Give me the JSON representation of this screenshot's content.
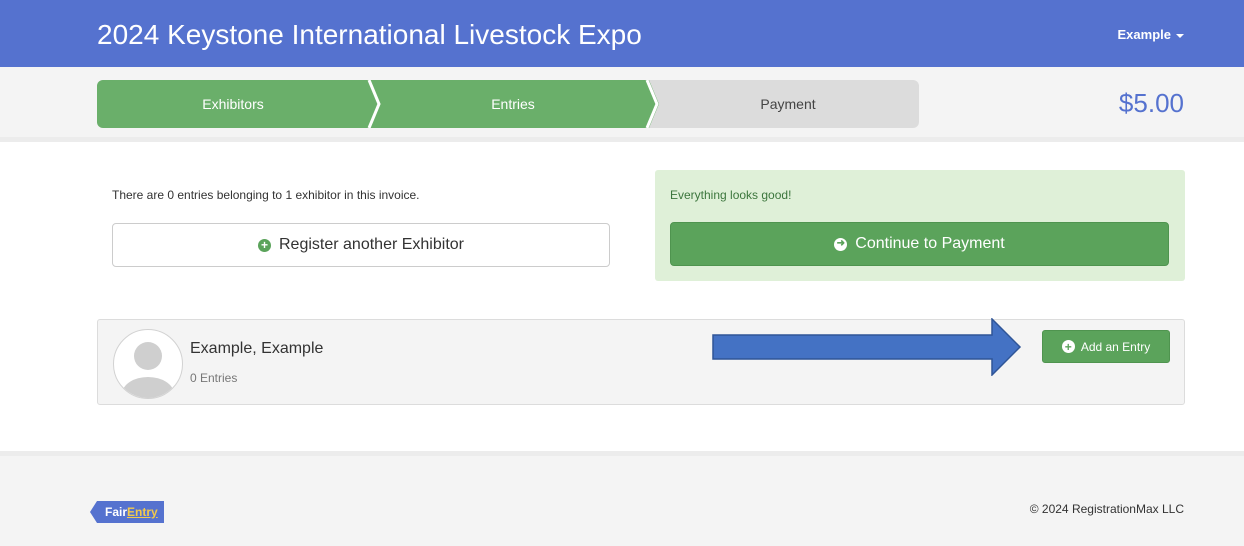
{
  "header": {
    "title": "2024 Keystone International Livestock Expo",
    "user_label": "Example"
  },
  "steps": [
    {
      "label": "Exhibitors",
      "state": "complete"
    },
    {
      "label": "Entries",
      "state": "active"
    },
    {
      "label": "Payment",
      "state": "pending"
    }
  ],
  "invoice_total": "$5.00",
  "summary_text": "There are 0 entries belonging to 1 exhibitor in this invoice.",
  "register_button": {
    "label": "Register another Exhibitor",
    "icon": "plus-circle-icon"
  },
  "status": {
    "message": "Everything looks good!",
    "continue_label": "Continue to Payment",
    "continue_icon": "arrow-right-circle-icon"
  },
  "exhibitor": {
    "name": "Example, Example",
    "entries_text": "0 Entries",
    "add_entry_label": "Add an Entry",
    "add_entry_icon": "plus-circle-icon"
  },
  "annotation": {
    "icon": "blue-arrow-right",
    "color": "#4472c4"
  },
  "footer": {
    "logo_fair": "Fair",
    "logo_entry": "Entry",
    "copyright": "© 2024 RegistrationMax LLC"
  },
  "colors": {
    "brand_blue": "#5572cf",
    "step_green": "#6aaf6a",
    "button_green": "#5ba35b",
    "success_bg": "#dff0d8",
    "step_pending": "#dcdcdc"
  }
}
